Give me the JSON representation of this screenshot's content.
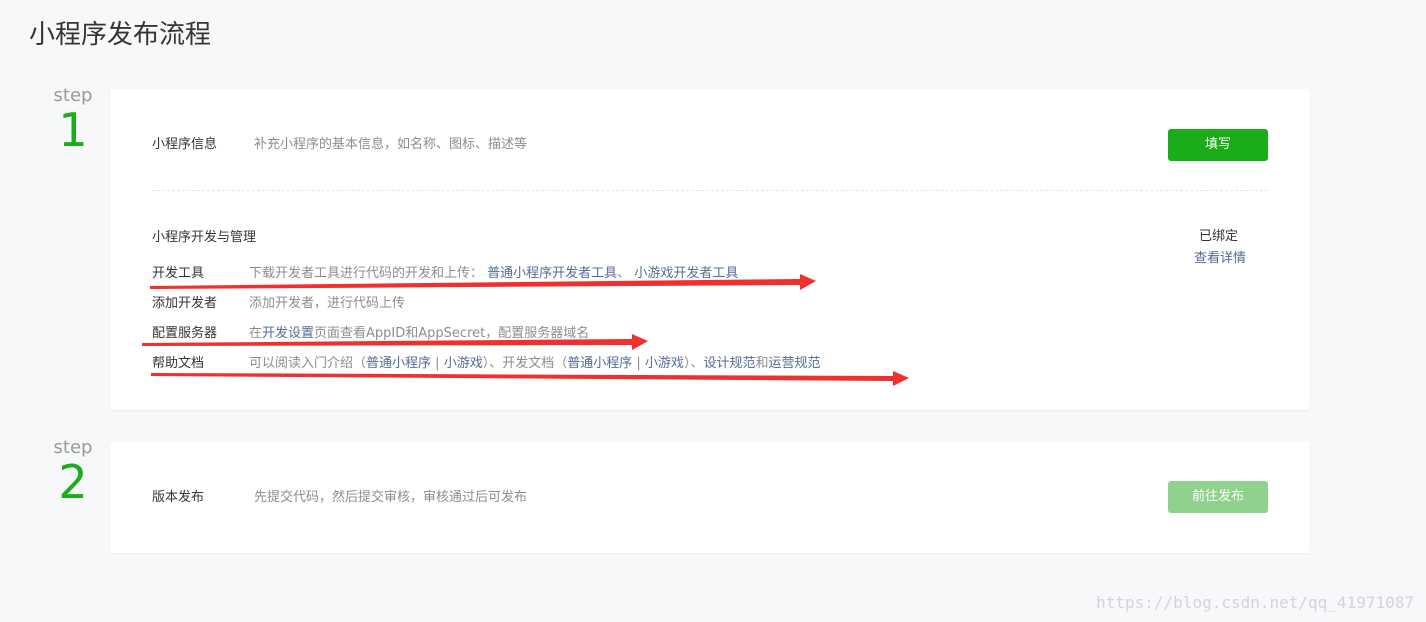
{
  "page_title": "小程序发布流程",
  "steps": [
    {
      "step_word": "step",
      "step_number": "1",
      "info_title": "小程序信息",
      "info_desc": "补充小程序的基本信息，如名称、图标、描述等",
      "fill_button": "填写",
      "dev_section": {
        "title": "小程序开发与管理",
        "status": "已绑定",
        "detail_link": "查看详情",
        "items": [
          {
            "label": "开发工具",
            "text": "下载开发者工具进行代码的开发和上传：",
            "link1": "普通小程序开发者工具",
            "sep": "、",
            "link2": "小游戏开发者工具"
          },
          {
            "label": "添加开发者",
            "text": "添加开发者，进行代码上传"
          },
          {
            "label": "配置服务器",
            "pre": "在",
            "link": "开发设置",
            "post": "页面查看AppID和AppSecret，配置服务器域名"
          },
          {
            "label": "帮助文档",
            "t1": "可以阅读入门介绍（",
            "l1": "普通小程序",
            "s1": "|",
            "l2": "小游戏",
            "t2": "）、开发文档（",
            "l3": "普通小程序",
            "s2": "|",
            "l4": "小游戏",
            "t3": "）、",
            "l5": "设计规范",
            "t4": "和",
            "l6": "运营规范"
          }
        ]
      }
    },
    {
      "step_word": "step",
      "step_number": "2",
      "title": "版本发布",
      "desc": "先提交代码，然后提交审核，审核通过后可发布",
      "publish_button": "前往发布"
    }
  ],
  "watermark": "https://blog.csdn.net/qq_41971087",
  "colors": {
    "accent_green": "#1aad19",
    "disabled_green": "#8ed28d",
    "link_blue": "#576b95",
    "annotation_red": "#f0302e"
  }
}
